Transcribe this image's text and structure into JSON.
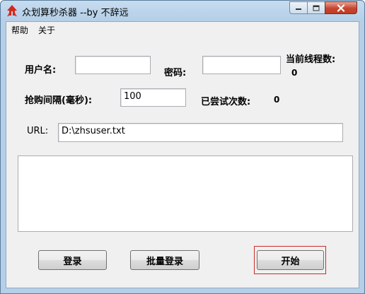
{
  "window": {
    "title": "众划算秒杀器 --by 不辞远"
  },
  "menu": [
    "帮助",
    "关于"
  ],
  "form": {
    "username_label": "用户名:",
    "username_value": "",
    "password_label": "密码:",
    "password_value": "",
    "thread_count_label": "当前线程数:",
    "thread_count_value": "0",
    "interval_label": "抢购间隔(毫秒):",
    "interval_value": "100",
    "attempts_label": "已尝试次数:",
    "attempts_value": "0",
    "url_label": "URL:",
    "url_value": "D:\\zhsuser.txt",
    "log_text": ""
  },
  "buttons": {
    "login": "登录",
    "batch_login": "批量登录",
    "start": "开始"
  },
  "colors": {
    "title_bar": "#b5cfe8",
    "close_button": "#c8452f",
    "focus_outline": "#cc2a2a"
  },
  "icons": [
    "app-logo-icon",
    "minimize-icon",
    "maximize-icon",
    "close-icon"
  ]
}
